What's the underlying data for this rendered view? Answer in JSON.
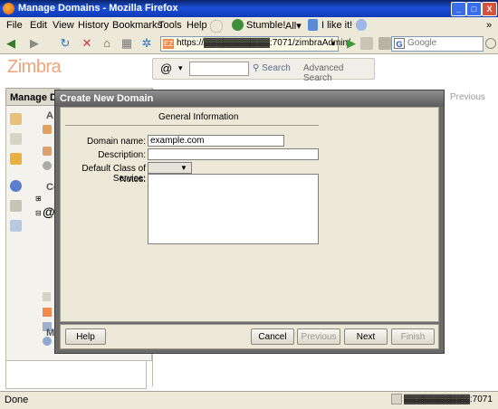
{
  "window": {
    "title": "Manage Domains - Mozilla Firefox",
    "minimize": "_",
    "maximize": "□",
    "close": "X"
  },
  "menu": {
    "items": [
      "File",
      "Edit",
      "View",
      "History",
      "Bookmarks",
      "Tools",
      "Help"
    ],
    "stumble": "Stumble!",
    "all": "All▾",
    "ilike": "I like it!",
    "more": "»"
  },
  "nav": {
    "url": "https://▓▓▓▓▓▓▓▓▓▓:7071/zimbraAdmin/",
    "search_placeholder": "Google"
  },
  "app": {
    "logo": "Zimbra",
    "search_icon_char": "@",
    "search_button": "Search",
    "advanced_search": "Advanced Search",
    "manage_tab": "Manage Domains",
    "previous_link": "Previous",
    "left_labels": {
      "a": "A",
      "co": "Co",
      "at": "@",
      "m": "M"
    }
  },
  "dialog": {
    "title": "Create New Domain",
    "section": "General Information",
    "fields": {
      "domain_name_label": "Domain name:",
      "domain_name_value": "example.com",
      "description_label": "Description:",
      "cos_label": "Default Class of Service:",
      "notes_label": "Notes:"
    },
    "buttons": {
      "help": "Help",
      "cancel": "Cancel",
      "previous": "Previous",
      "next": "Next",
      "finish": "Finish"
    }
  },
  "status": {
    "left": "Done",
    "right": "▓▓▓▓▓▓▓▓▓▓:7071"
  },
  "colors": {
    "titlebar": "#1b4fd6",
    "dialog_frame": "#6b6b6b",
    "zimbra_orange": "#f0a37a"
  }
}
